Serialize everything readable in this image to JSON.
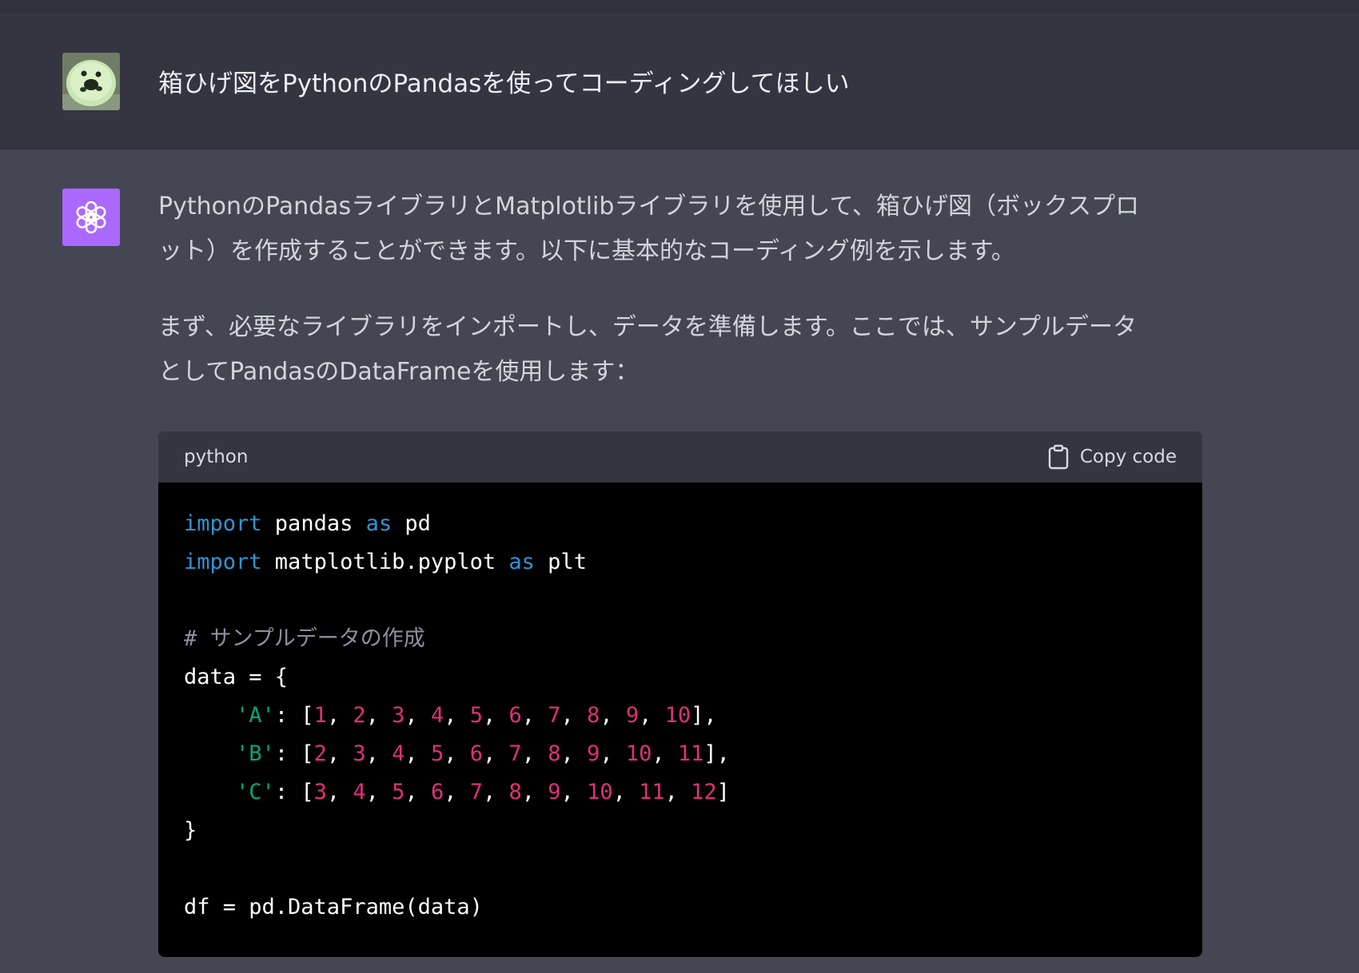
{
  "user_message": {
    "text": "箱ひげ図をPythonのPandasを使ってコーディングしてほしい"
  },
  "assistant_message": {
    "paragraph1_lines": [
      "PythonのPandasライブラリとMatplotlibライブラリを使用して、箱ひげ図（ボックスプロ",
      "ット）を作成することができます。以下に基本的なコーディング例を示します。"
    ],
    "paragraph2_lines": [
      "まず、必要なライブラリをインポートし、データを準備します。ここでは、サンプルデータ",
      "としてPandasのDataFrameを使用します："
    ],
    "code_block": {
      "language": "python",
      "copy_label": "Copy code",
      "tokens": {
        "import": "import",
        "as": "as",
        "pandas": " pandas ",
        "pd": " pd",
        "matplotlib": " matplotlib.pyplot ",
        "plt": " plt",
        "comment": "# サンプルデータの作成",
        "data_open": "data = {",
        "key_a": "'A'",
        "key_b": "'B'",
        "key_c": "'C'",
        "close_brace": "}",
        "df_line": "df = pd.DataFrame(data)"
      },
      "values": {
        "A": [
          "1",
          "2",
          "3",
          "4",
          "5",
          "6",
          "7",
          "8",
          "9",
          "10"
        ],
        "B": [
          "2",
          "3",
          "4",
          "5",
          "6",
          "7",
          "8",
          "9",
          "10",
          "11"
        ],
        "C": [
          "3",
          "4",
          "5",
          "6",
          "7",
          "8",
          "9",
          "10",
          "11",
          "12"
        ]
      }
    }
  },
  "colors": {
    "page_bg": "#444654",
    "user_row_bg": "#343541",
    "assistant_avatar_bg": "#ab68ff",
    "code_bg": "#000000",
    "keyword": "#2e95d3",
    "string": "#00a67d",
    "number": "#df3079",
    "comment": "#8e8ea0"
  },
  "icons": {
    "user_avatar": "user-avatar-image",
    "assistant_avatar": "openai-logo-icon",
    "copy": "clipboard-icon"
  }
}
